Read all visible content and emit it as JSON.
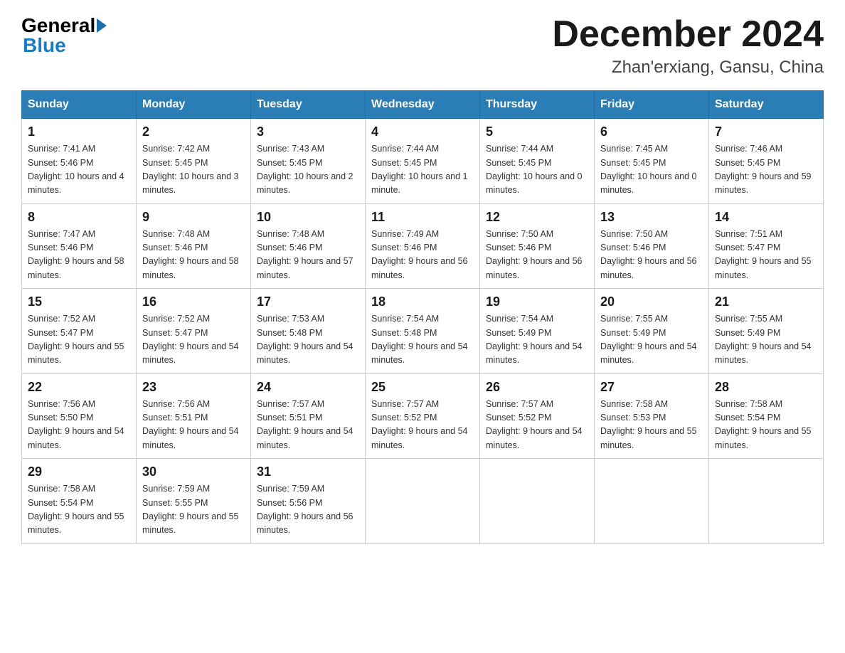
{
  "header": {
    "logo_general": "General",
    "logo_blue": "Blue",
    "month_title": "December 2024",
    "location": "Zhan'erxiang, Gansu, China"
  },
  "days_of_week": [
    "Sunday",
    "Monday",
    "Tuesday",
    "Wednesday",
    "Thursday",
    "Friday",
    "Saturday"
  ],
  "weeks": [
    [
      {
        "day": "1",
        "sunrise": "7:41 AM",
        "sunset": "5:46 PM",
        "daylight": "10 hours and 4 minutes."
      },
      {
        "day": "2",
        "sunrise": "7:42 AM",
        "sunset": "5:45 PM",
        "daylight": "10 hours and 3 minutes."
      },
      {
        "day": "3",
        "sunrise": "7:43 AM",
        "sunset": "5:45 PM",
        "daylight": "10 hours and 2 minutes."
      },
      {
        "day": "4",
        "sunrise": "7:44 AM",
        "sunset": "5:45 PM",
        "daylight": "10 hours and 1 minute."
      },
      {
        "day": "5",
        "sunrise": "7:44 AM",
        "sunset": "5:45 PM",
        "daylight": "10 hours and 0 minutes."
      },
      {
        "day": "6",
        "sunrise": "7:45 AM",
        "sunset": "5:45 PM",
        "daylight": "10 hours and 0 minutes."
      },
      {
        "day": "7",
        "sunrise": "7:46 AM",
        "sunset": "5:45 PM",
        "daylight": "9 hours and 59 minutes."
      }
    ],
    [
      {
        "day": "8",
        "sunrise": "7:47 AM",
        "sunset": "5:46 PM",
        "daylight": "9 hours and 58 minutes."
      },
      {
        "day": "9",
        "sunrise": "7:48 AM",
        "sunset": "5:46 PM",
        "daylight": "9 hours and 58 minutes."
      },
      {
        "day": "10",
        "sunrise": "7:48 AM",
        "sunset": "5:46 PM",
        "daylight": "9 hours and 57 minutes."
      },
      {
        "day": "11",
        "sunrise": "7:49 AM",
        "sunset": "5:46 PM",
        "daylight": "9 hours and 56 minutes."
      },
      {
        "day": "12",
        "sunrise": "7:50 AM",
        "sunset": "5:46 PM",
        "daylight": "9 hours and 56 minutes."
      },
      {
        "day": "13",
        "sunrise": "7:50 AM",
        "sunset": "5:46 PM",
        "daylight": "9 hours and 56 minutes."
      },
      {
        "day": "14",
        "sunrise": "7:51 AM",
        "sunset": "5:47 PM",
        "daylight": "9 hours and 55 minutes."
      }
    ],
    [
      {
        "day": "15",
        "sunrise": "7:52 AM",
        "sunset": "5:47 PM",
        "daylight": "9 hours and 55 minutes."
      },
      {
        "day": "16",
        "sunrise": "7:52 AM",
        "sunset": "5:47 PM",
        "daylight": "9 hours and 54 minutes."
      },
      {
        "day": "17",
        "sunrise": "7:53 AM",
        "sunset": "5:48 PM",
        "daylight": "9 hours and 54 minutes."
      },
      {
        "day": "18",
        "sunrise": "7:54 AM",
        "sunset": "5:48 PM",
        "daylight": "9 hours and 54 minutes."
      },
      {
        "day": "19",
        "sunrise": "7:54 AM",
        "sunset": "5:49 PM",
        "daylight": "9 hours and 54 minutes."
      },
      {
        "day": "20",
        "sunrise": "7:55 AM",
        "sunset": "5:49 PM",
        "daylight": "9 hours and 54 minutes."
      },
      {
        "day": "21",
        "sunrise": "7:55 AM",
        "sunset": "5:49 PM",
        "daylight": "9 hours and 54 minutes."
      }
    ],
    [
      {
        "day": "22",
        "sunrise": "7:56 AM",
        "sunset": "5:50 PM",
        "daylight": "9 hours and 54 minutes."
      },
      {
        "day": "23",
        "sunrise": "7:56 AM",
        "sunset": "5:51 PM",
        "daylight": "9 hours and 54 minutes."
      },
      {
        "day": "24",
        "sunrise": "7:57 AM",
        "sunset": "5:51 PM",
        "daylight": "9 hours and 54 minutes."
      },
      {
        "day": "25",
        "sunrise": "7:57 AM",
        "sunset": "5:52 PM",
        "daylight": "9 hours and 54 minutes."
      },
      {
        "day": "26",
        "sunrise": "7:57 AM",
        "sunset": "5:52 PM",
        "daylight": "9 hours and 54 minutes."
      },
      {
        "day": "27",
        "sunrise": "7:58 AM",
        "sunset": "5:53 PM",
        "daylight": "9 hours and 55 minutes."
      },
      {
        "day": "28",
        "sunrise": "7:58 AM",
        "sunset": "5:54 PM",
        "daylight": "9 hours and 55 minutes."
      }
    ],
    [
      {
        "day": "29",
        "sunrise": "7:58 AM",
        "sunset": "5:54 PM",
        "daylight": "9 hours and 55 minutes."
      },
      {
        "day": "30",
        "sunrise": "7:59 AM",
        "sunset": "5:55 PM",
        "daylight": "9 hours and 55 minutes."
      },
      {
        "day": "31",
        "sunrise": "7:59 AM",
        "sunset": "5:56 PM",
        "daylight": "9 hours and 56 minutes."
      },
      null,
      null,
      null,
      null
    ]
  ]
}
